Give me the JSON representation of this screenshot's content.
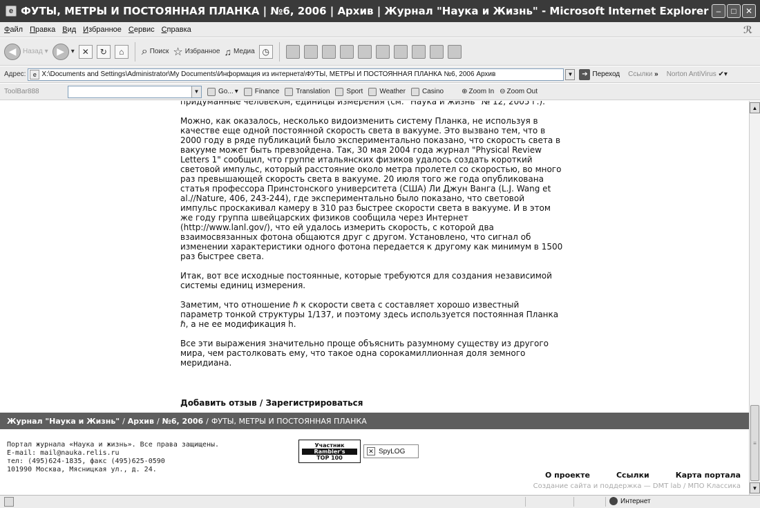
{
  "window": {
    "title": "ФУТЫ, МЕТРЫ И ПОСТОЯННАЯ ПЛАНКА | №6, 2006 | Архив | Журнал \"Наука и Жизнь\" - Microsoft Internet Explorer"
  },
  "menu": {
    "items": [
      "Файл",
      "Правка",
      "Вид",
      "Избранное",
      "Сервис",
      "Справка"
    ]
  },
  "toolbar": {
    "back_label": "Назад",
    "search_label": "Поиск",
    "favorites_label": "Избранное",
    "media_label": "Медиа"
  },
  "address": {
    "label": "Адрес:",
    "value": "X:\\Documents and Settings\\Administrator\\My Documents\\Информация из интернета\\ФУТЫ, МЕТРЫ И ПОСТОЯННАЯ ПЛАНКА  №6, 2006  Архив",
    "go_label": "Переход",
    "links_label": "Ссылки",
    "norton_label": "Norton AntiVirus"
  },
  "toolbar888": {
    "label": "ToolBar888",
    "go_label": "Go...",
    "items": [
      "Finance",
      "Translation",
      "Sport",
      "Weather",
      "Casino"
    ],
    "zoom_in": "Zoom In",
    "zoom_out": "Zoom Out"
  },
  "article": {
    "paragraphs": [
      "придуманные человеком, единицы измерения (см. \"Наука и жизнь\" № 12, 2005 г.).",
      "Можно, как оказалось, несколько видоизменить систему Планка, не используя в\nкачестве еще одной постоянной скорость света в вакууме. Это вызвано тем, что в\n2000 году в ряде публикаций было экспериментально показано, что скорость света в\nвакууме может быть превзойдена. Так, 30 мая 2004 года журнал \"Physical Review\nLetters 1\" сообщил, что группе итальянских физиков удалось создать короткий\nсветовой импульс, который расстояние около метра пролетел со скоростью, во много\nраз превышающей скорость света в вакууме. 20 июля того же года опубликована\nстатья профессора Принстонского университета (США) Ли Джун Ванга (L.J. Wang et\nal.//Nature, 406, 243-244), где экспериментально было показано, что световой\nимпульс проскакивал камеру в 310 раз быстрее скорости света в вакууме. И в этом\nже году группа швейцарских физиков сообщила через Интернет\n(http://www.lanl.gov/), что ей удалось измерить скорость, с которой два\nвзаимосвязанных фотона общаются друг с другом. Установлено, что сигнал об\nизменении характеристики одного фотона передается к другому как минимум в 1500\nраз быстрее света.",
      "Итак, вот все исходные постоянные, которые требуются для создания независимой\nсистемы единиц измерения.",
      "Заметим, что отношение ℏ к скорости света c составляет хорошо известный\nпараметр тонкой структуры 1/137, и поэтому здесь используется постоянная Планка\nℏ, а не ее модификация h.",
      "Все эти выражения значительно проще объяснить разумному существу из другого\nмира, чем растолковать ему, что такое одна сорокамиллионная доля земного\nмеридиана."
    ],
    "feedback_link": "Добавить отзыв",
    "register_link": "Зарегистрироваться",
    "feedback_sep": " / "
  },
  "breadcrumb": {
    "journal": "Журнал \"Наука и Жизнь\"",
    "archive": "Архив",
    "issue": "№6, 2006",
    "current": "ФУТЫ, МЕТРЫ И ПОСТОЯННАЯ ПЛАНКА",
    "sep": "/"
  },
  "footer": {
    "lines": [
      "Портал журнала «Наука и жизнь». Все права защищены.",
      "E-mail: mail@nauka.relis.ru",
      "тел: (495)624-1835, факс (495)625-0590",
      "101990 Москва, Мясницкая ул., д. 24."
    ],
    "rambler_top": "Участник",
    "rambler_mid": "Rambler's",
    "rambler_bottom": "TOP 100",
    "spylog": "SpyLOG",
    "links": [
      "О проекте",
      "Ссылки",
      "Карта портала"
    ],
    "credits": "Создание сайта и поддержка — DMT lab / МПО Классика"
  },
  "status": {
    "zone": "Интернет"
  }
}
